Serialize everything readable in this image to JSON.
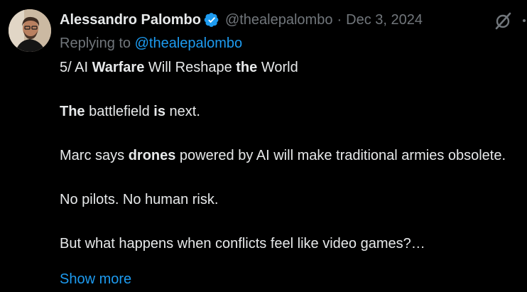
{
  "author": {
    "display_name": "Alessandro Palombo",
    "handle": "@thealepalombo",
    "separator": "·",
    "date": "Dec 3, 2024",
    "verified_icon": "verified-badge-icon",
    "avatar": "avatar"
  },
  "reply_to": {
    "prefix": "Replying to",
    "handle": "@thealepalombo"
  },
  "actions": {
    "grok_icon": "grok-icon",
    "more_icon": "more-icon"
  },
  "body": {
    "p1": {
      "a": "5/ AI ",
      "b": "Warfare",
      "c": " Will Reshape ",
      "d": "the",
      "e": " World"
    },
    "p2": {
      "a": "The",
      "b": " battlefield ",
      "c": "is",
      "d": " next."
    },
    "p3": {
      "a": "Marc says ",
      "b": "drones",
      "c": " powered by AI will make traditional armies obsolete."
    },
    "p4": "No pilots. No human risk.",
    "p5": "But what happens when conflicts feel like video games?…"
  },
  "show_more_label": "Show more",
  "colors": {
    "background": "#000000",
    "text": "#e7e9ea",
    "muted": "#71767b",
    "link": "#1d9bf0",
    "verified": "#1d9bf0"
  }
}
